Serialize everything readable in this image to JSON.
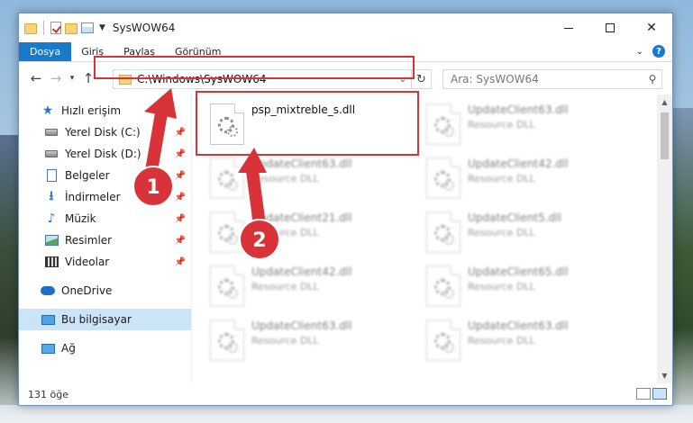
{
  "window": {
    "title": "SysWOW64"
  },
  "ribbon": {
    "tabs": [
      "Dosya",
      "Giriş",
      "Paylaş",
      "Görünüm"
    ]
  },
  "address": {
    "path": "C:\\Windows\\SysWOW64",
    "search_placeholder": "Ara: SysWOW64"
  },
  "sidebar": {
    "items": [
      {
        "label": "Hızlı erişim",
        "icon": "star-icon"
      },
      {
        "label": "Yerel Disk (C:)",
        "icon": "disk-icon",
        "pinned": true
      },
      {
        "label": "Yerel Disk (D:)",
        "icon": "disk-icon",
        "pinned": true
      },
      {
        "label": "Belgeler",
        "icon": "documents-icon",
        "pinned": true
      },
      {
        "label": "İndirmeler",
        "icon": "download-icon",
        "pinned": true
      },
      {
        "label": "Müzik",
        "icon": "music-icon",
        "pinned": true
      },
      {
        "label": "Resimler",
        "icon": "pictures-icon",
        "pinned": true
      },
      {
        "label": "Videolar",
        "icon": "videos-icon",
        "pinned": true
      },
      {
        "label": "OneDrive",
        "icon": "onedrive-icon"
      },
      {
        "label": "Bu bilgisayar",
        "icon": "this-pc-icon",
        "selected": true
      },
      {
        "label": "Ağ",
        "icon": "network-icon"
      }
    ]
  },
  "files": [
    {
      "name": "psp_mixtreble_s.dll",
      "type": "",
      "blurred": false
    },
    {
      "name": "UpdateClient63.dll",
      "type": "Resource DLL",
      "blurred": true
    },
    {
      "name": "UpdateClient63.dll",
      "type": "Resource DLL",
      "blurred": true
    },
    {
      "name": "UpdateClient42.dll",
      "type": "Resource DLL",
      "blurred": true
    },
    {
      "name": "UpdateClient21.dll",
      "type": "Resource DLL",
      "blurred": true
    },
    {
      "name": "UpdateClient5.dll",
      "type": "Resource DLL",
      "blurred": true
    },
    {
      "name": "UpdateClient42.dll",
      "type": "Resource DLL",
      "blurred": true
    },
    {
      "name": "UpdateClient65.dll",
      "type": "Resource DLL",
      "blurred": true
    },
    {
      "name": "UpdateClient63.dll",
      "type": "Resource DLL",
      "blurred": true
    },
    {
      "name": "UpdateClient63.dll",
      "type": "Resource DLL",
      "blurred": true
    }
  ],
  "status": {
    "count": "131 öğe"
  },
  "annotations": {
    "step1": "1",
    "step2": "2",
    "color": "#d9333a"
  }
}
